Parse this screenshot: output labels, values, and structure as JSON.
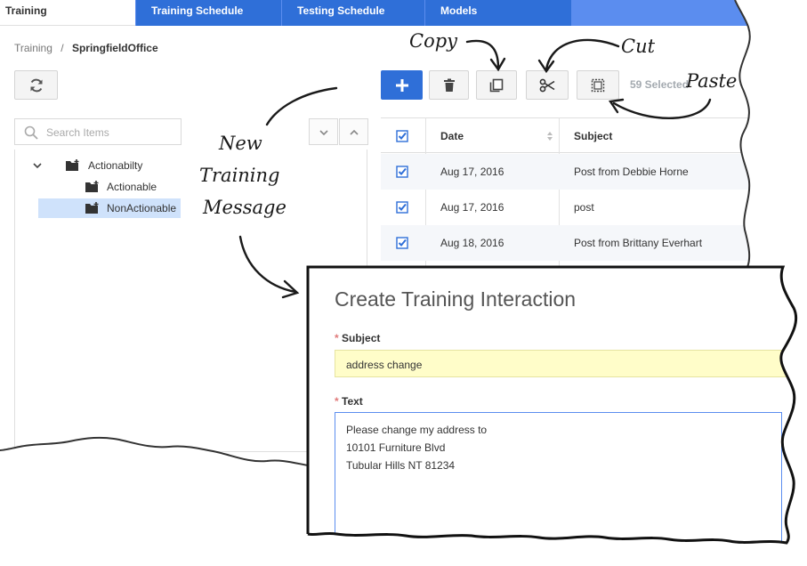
{
  "tabs": [
    {
      "label": "Training",
      "active": true
    },
    {
      "label": "Training Schedule",
      "active": false
    },
    {
      "label": "Testing Schedule",
      "active": false
    },
    {
      "label": "Models",
      "active": false
    }
  ],
  "breadcrumb": {
    "root": "Training",
    "separator": "/",
    "current": "SpringfieldOffice"
  },
  "toolbar": {
    "selected_label": "59 Selected"
  },
  "search": {
    "placeholder": "Search Items"
  },
  "tree": [
    {
      "label": "Actionabilty",
      "level": 0
    },
    {
      "label": "Actionable",
      "level": 1
    },
    {
      "label": "NonActionable",
      "level": 1,
      "selected": true
    }
  ],
  "table": {
    "headers": {
      "date": "Date",
      "subject": "Subject"
    },
    "rows": [
      {
        "date": "Aug 17, 2016",
        "subject": "Post from Debbie Horne",
        "checked": true
      },
      {
        "date": "Aug 17, 2016",
        "subject": "post",
        "checked": true
      },
      {
        "date": "Aug 18, 2016",
        "subject": "Post from Brittany Everhart",
        "checked": true
      }
    ]
  },
  "annotations": {
    "copy": "Copy",
    "cut": "Cut",
    "paste": "Paste",
    "new_line1": "New",
    "new_line2": "Training",
    "new_line3": "Message"
  },
  "dialog": {
    "title": "Create Training Interaction",
    "subject_label": "Subject",
    "subject_value": "address change",
    "text_label": "Text",
    "text_lines": [
      "Please change my address to",
      "10101 Furniture Blvd",
      "Tubular Hills NT 81234"
    ]
  },
  "colors": {
    "accent": "#2f6fd8",
    "tab_bar": "#5b8def",
    "highlight": "#fffdc9",
    "selected_row": "#cfe2fb"
  }
}
